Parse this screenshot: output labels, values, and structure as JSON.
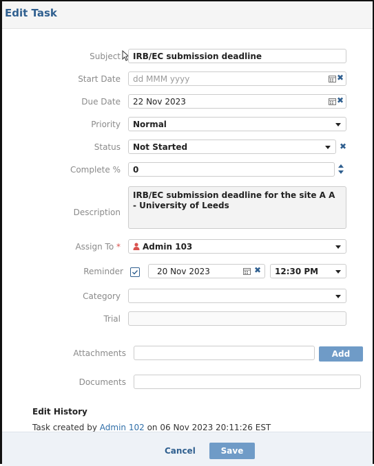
{
  "dialog": {
    "title": "Edit Task"
  },
  "fields": {
    "subject": {
      "label": "Subject",
      "value": "IRB/EC submission deadline"
    },
    "start_date": {
      "label": "Start Date",
      "placeholder": "dd MMM yyyy"
    },
    "due_date": {
      "label": "Due Date",
      "value": "22 Nov 2023"
    },
    "priority": {
      "label": "Priority",
      "value": "Normal"
    },
    "status": {
      "label": "Status",
      "value": "Not Started"
    },
    "complete": {
      "label": "Complete %",
      "value": "0"
    },
    "description": {
      "label": "Description",
      "value": "IRB/EC submission deadline for the site A A - University of Leeds"
    },
    "assign_to": {
      "label": "Assign To",
      "required_mark": "*",
      "value": "Admin 103"
    },
    "reminder": {
      "label": "Reminder",
      "checked": true,
      "date": "20 Nov 2023",
      "time": "12:30 PM"
    },
    "category": {
      "label": "Category",
      "value": ""
    },
    "trial": {
      "label": "Trial",
      "value": ""
    },
    "attachments": {
      "label": "Attachments",
      "value": "",
      "add_label": "Add"
    },
    "documents": {
      "label": "Documents",
      "value": ""
    }
  },
  "history": {
    "title": "Edit History",
    "prefix": "Task created by",
    "user": "Admin 102",
    "suffix": "on 06 Nov 2023 20:11:26 EST"
  },
  "footer": {
    "cancel_label": "Cancel",
    "save_label": "Save"
  },
  "icons": {
    "calendar": "calendar-icon",
    "clear": "close-icon",
    "user": "user-icon",
    "dropdown": "caret-down-icon"
  },
  "colors": {
    "accent": "#2f5f8f",
    "button": "#6f9bc7",
    "required": "#d9534f"
  }
}
